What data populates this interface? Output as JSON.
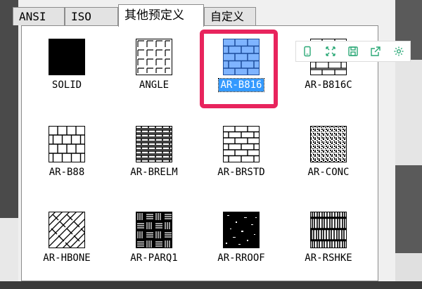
{
  "tabs": [
    {
      "label": "ANSI"
    },
    {
      "label": "ISO"
    },
    {
      "label": "其他预定义"
    },
    {
      "label": "自定义"
    }
  ],
  "patterns": [
    {
      "label": "SOLID"
    },
    {
      "label": "ANGLE"
    },
    {
      "label": "AR-B816"
    },
    {
      "label": "AR-B816C"
    },
    {
      "label": "AR-B88"
    },
    {
      "label": "AR-BRELM"
    },
    {
      "label": "AR-BRSTD"
    },
    {
      "label": "AR-CONC"
    },
    {
      "label": "AR-HBONE"
    },
    {
      "label": "AR-PARQ1"
    },
    {
      "label": "AR-RROOF"
    },
    {
      "label": "AR-RSHKE"
    }
  ],
  "selected_pattern": "AR-B816",
  "toolbar_icons": [
    "phone-icon",
    "expand-icon",
    "save-icon",
    "share-icon",
    "gear-icon"
  ],
  "colors": {
    "highlight": "#e8245d",
    "selection": "#3399ff",
    "toolbar_icon": "#2aa876"
  }
}
